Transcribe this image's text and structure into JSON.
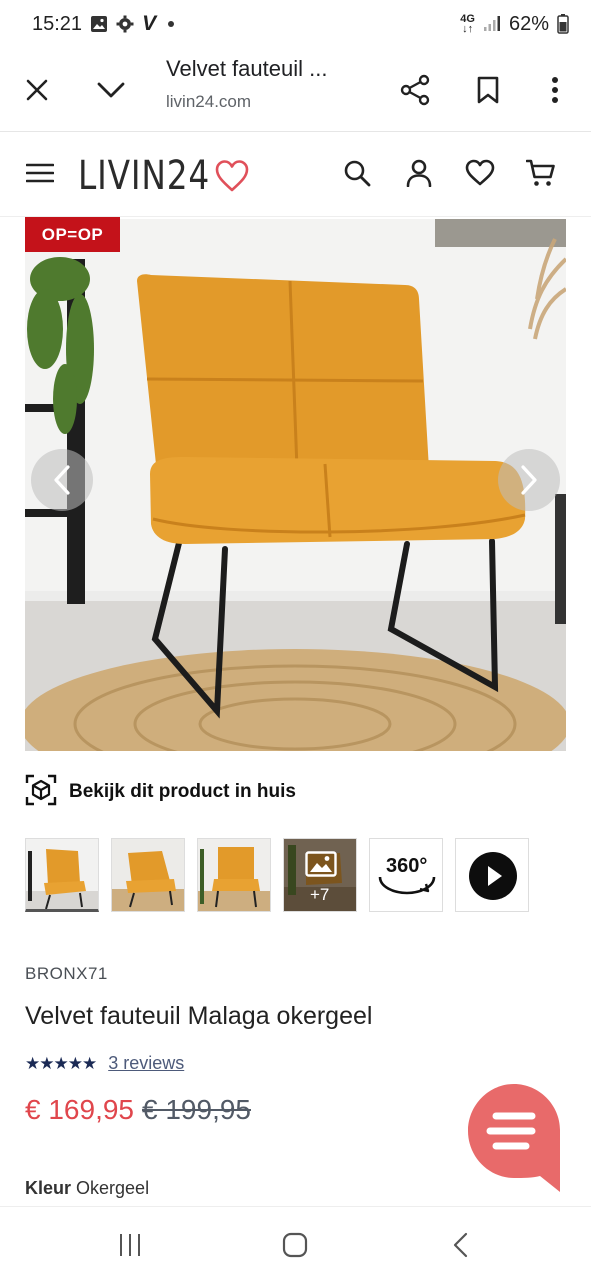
{
  "status_bar": {
    "time": "15:21",
    "network": "4G",
    "battery": "62%",
    "app_indicator": "V",
    "icons": [
      "image-icon",
      "gear-icon",
      "v-app-icon",
      "notification-dot-icon",
      "signal-icon",
      "battery-icon"
    ]
  },
  "browser": {
    "title": "Velvet fauteuil ...",
    "url": "livin24.com",
    "icons": [
      "close-icon",
      "chevron-down-icon",
      "share-icon",
      "bookmark-icon",
      "more-vert-icon"
    ]
  },
  "header": {
    "logo_text": "LIVIN24",
    "icons": [
      "menu-icon",
      "heart-logo-icon",
      "search-icon",
      "account-icon",
      "wishlist-heart-icon",
      "cart-icon"
    ]
  },
  "gallery": {
    "badge": "OP=OP",
    "more_count": "+7",
    "label_360": "360°",
    "icons": [
      "chevron-left-icon",
      "chevron-right-icon",
      "gallery-image-icon",
      "play-icon"
    ]
  },
  "ar": {
    "label": "Bekijk dit product in huis",
    "icon": "ar-cube-icon"
  },
  "product": {
    "brand": "BRONX71",
    "title": "Velvet fauteuil Malaga okergeel",
    "stars": "★★★★★",
    "rating": 5,
    "reviews": "3 reviews",
    "price": "€ 169,95",
    "old_price": "€ 199,95",
    "color_label": "Kleur",
    "color_value": "Okergeel"
  },
  "colors": {
    "badge": "#c4121a",
    "price": "#e0464c",
    "chat": "#e86a6a",
    "logo_heart": "#e0505a",
    "chair": "#e29a2a"
  },
  "chat": {
    "icon": "chat-bubble-icon"
  },
  "nav": {
    "icons": [
      "recent-apps-icon",
      "home-icon",
      "back-icon"
    ]
  }
}
